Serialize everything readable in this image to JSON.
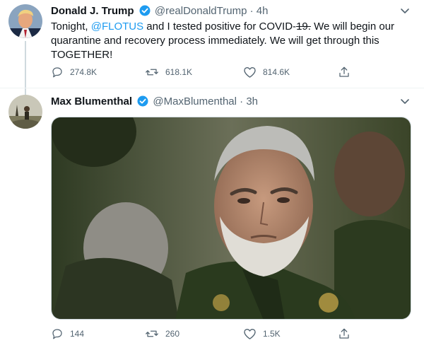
{
  "tweets": [
    {
      "name": "Donald J. Trump",
      "handle": "@realDonaldTrump",
      "time": "4h",
      "text_before": "Tonight, ",
      "mention": "@FLOTUS",
      "text_middle": " and I tested positive for COVID-",
      "text_struck": "19.",
      "text_after": " We will begin our quarantine and recovery process immediately. We will get through this TOGETHER!",
      "stats": {
        "replies": "274.8K",
        "retweets": "618.1K",
        "likes": "814.6K"
      }
    },
    {
      "name": "Max Blumenthal",
      "handle": "@MaxBlumenthal",
      "time": "3h",
      "stats": {
        "replies": "144",
        "retweets": "260",
        "likes": "1.5K"
      }
    }
  ],
  "separator": "·",
  "colors": {
    "accent": "#1d9bf0",
    "muted": "#536471",
    "text": "#0f1419"
  },
  "icons": [
    "verified-badge-icon",
    "chevron-down-icon",
    "reply-icon",
    "retweet-icon",
    "like-icon",
    "share-icon"
  ]
}
